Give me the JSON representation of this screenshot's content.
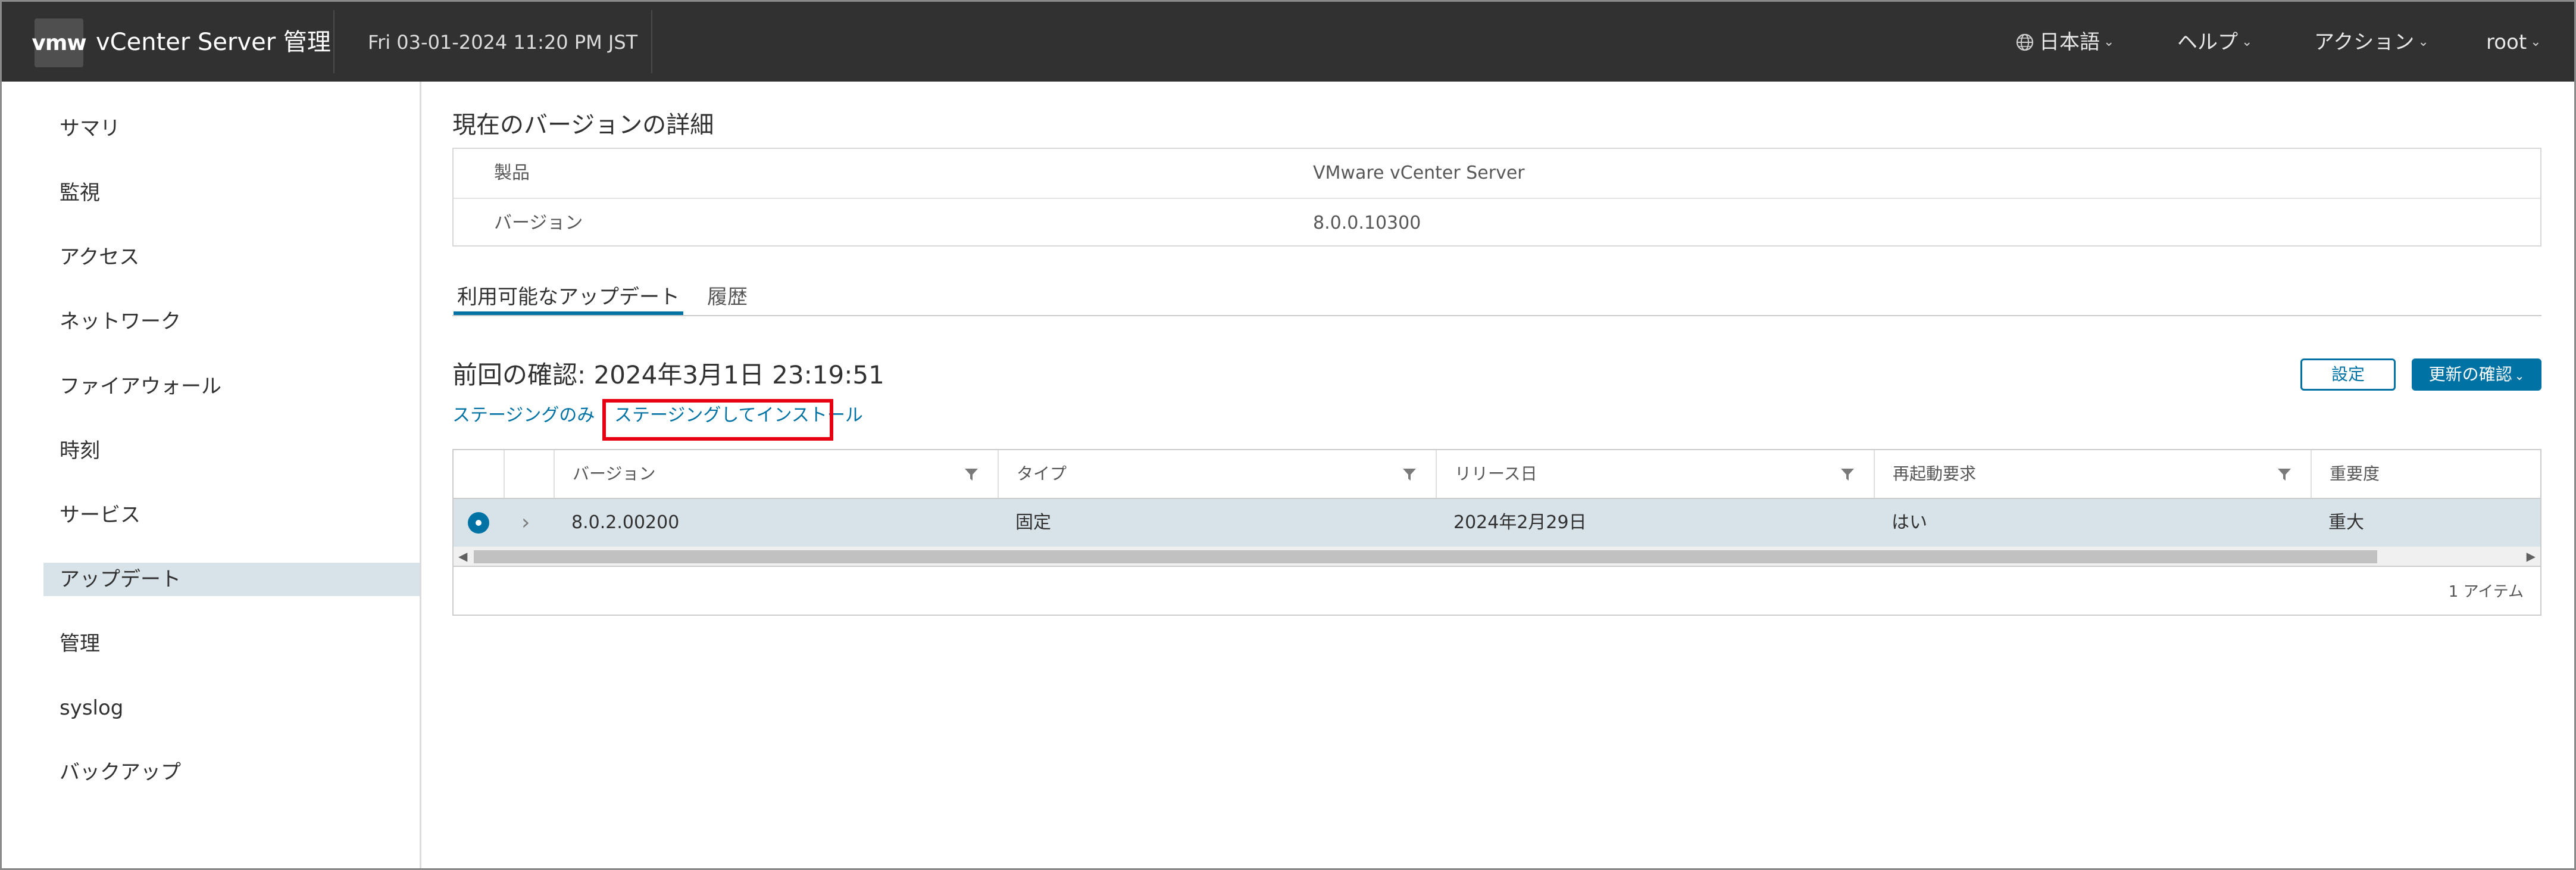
{
  "header": {
    "logo_text": "vmw",
    "app_title": "vCenter Server 管理",
    "datetime": "Fri 03-01-2024 11:20 PM JST",
    "menus": {
      "language": "日本語",
      "help": "ヘルプ",
      "actions": "アクション",
      "user": "root"
    },
    "icons": {
      "language": "globe-icon",
      "dropdown": "chevron-down-icon"
    }
  },
  "sidebar": {
    "items": [
      {
        "label": "サマリ",
        "active": false
      },
      {
        "label": "監視",
        "active": false
      },
      {
        "label": "アクセス",
        "active": false
      },
      {
        "label": "ネットワーク",
        "active": false
      },
      {
        "label": "ファイアウォール",
        "active": false
      },
      {
        "label": "時刻",
        "active": false
      },
      {
        "label": "サービス",
        "active": false
      },
      {
        "label": "アップデート",
        "active": true
      },
      {
        "label": "管理",
        "active": false
      },
      {
        "label": "syslog",
        "active": false
      },
      {
        "label": "バックアップ",
        "active": false
      }
    ]
  },
  "details": {
    "title": "現在のバージョンの詳細",
    "rows": [
      {
        "key": "製品",
        "value": "VMware vCenter Server"
      },
      {
        "key": "バージョン",
        "value": "8.0.0.10300"
      }
    ]
  },
  "tabs": [
    {
      "label": "利用可能なアップデート",
      "active": true
    },
    {
      "label": "履歴",
      "active": false
    }
  ],
  "updates": {
    "last_check": "前回の確認: 2024年3月1日 23:19:51",
    "settings_button": "設定",
    "check_button": "更新の確認",
    "links": {
      "stage_only": "ステージングのみ",
      "stage_and_install": "ステージングしてインストール"
    },
    "highlight_color": "#e60012"
  },
  "grid": {
    "columns": [
      "バージョン",
      "タイプ",
      "リリース日",
      "再起動要求",
      "重要度"
    ],
    "rows": [
      {
        "selected": true,
        "version": "8.0.2.00200",
        "type": "固定",
        "release_date": "2024年2月29日",
        "reboot": "はい",
        "severity": "重大"
      }
    ],
    "footer": "1 アイテム",
    "icons": {
      "filter": "filter-icon",
      "expand": "chevron-right-icon",
      "radio": "radio-selected-icon"
    }
  },
  "colors": {
    "header_bg": "#313131",
    "accent": "#0072a3",
    "selected_row": "#d8e3e9"
  }
}
